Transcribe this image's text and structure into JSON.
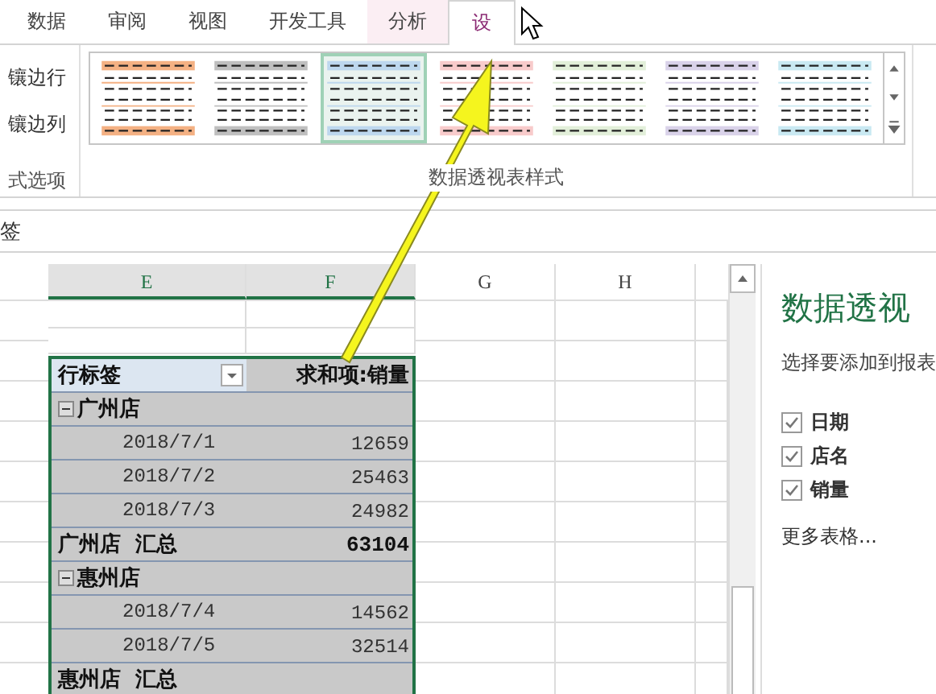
{
  "ribbon": {
    "tabs": [
      {
        "label": "数据",
        "selected": false,
        "contextual": false
      },
      {
        "label": "审阅",
        "selected": false,
        "contextual": false
      },
      {
        "label": "视图",
        "selected": false,
        "contextual": false
      },
      {
        "label": "开发工具",
        "selected": false,
        "contextual": false
      },
      {
        "label": "分析",
        "selected": false,
        "contextual": true
      },
      {
        "label": "设",
        "selected": true,
        "contextual": true
      }
    ],
    "options": [
      {
        "label": "镶边行"
      },
      {
        "label": "镶边列"
      }
    ],
    "options_group_label": "式选项",
    "styles": [
      {
        "color": "#f4b183",
        "selected": false
      },
      {
        "color": "#bfbfbf",
        "selected": false
      },
      {
        "color": "#bdd7ee",
        "selected": true
      },
      {
        "color": "#f8cbcb",
        "selected": false
      },
      {
        "color": "#e2efd9",
        "selected": false
      },
      {
        "color": "#d9d2e9",
        "selected": false
      },
      {
        "color": "#c9e9f2",
        "selected": false
      }
    ],
    "styles_group_label": "数据透视表样式"
  },
  "formula_bar": {
    "value": "签"
  },
  "columns": [
    {
      "label": "E",
      "selected": true
    },
    {
      "label": "F",
      "selected": true
    },
    {
      "label": "G",
      "selected": false
    },
    {
      "label": "H",
      "selected": false
    }
  ],
  "pivot": {
    "header_label": "行标签",
    "header_value": "求和项:销量",
    "groups": [
      {
        "name": "广州店",
        "expanded": true,
        "items": [
          {
            "date": "2018/7/1",
            "value": "12659"
          },
          {
            "date": "2018/7/2",
            "value": "25463"
          },
          {
            "date": "2018/7/3",
            "value": "24982"
          }
        ],
        "subtotal_label": "广州店  汇总",
        "subtotal_value": "63104"
      },
      {
        "name": "惠州店",
        "expanded": true,
        "items": [
          {
            "date": "2018/7/4",
            "value": "14562"
          },
          {
            "date": "2018/7/5",
            "value": "32514"
          }
        ],
        "subtotal_label": "惠州店  汇总"
      }
    ]
  },
  "field_pane": {
    "title": "数据透视",
    "hint": "选择要添加到报表",
    "fields": [
      {
        "label": "日期",
        "checked": true
      },
      {
        "label": "店名",
        "checked": true
      },
      {
        "label": "销量",
        "checked": true
      }
    ],
    "more_link": "更多表格..."
  }
}
